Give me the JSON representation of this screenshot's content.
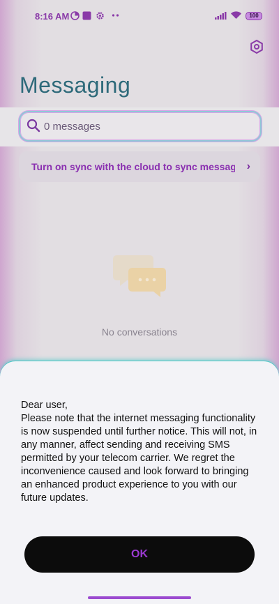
{
  "status_bar": {
    "time": "8:16 AM",
    "battery": "100",
    "icons": [
      "data-saver-icon",
      "app-notification-icon",
      "settings-notification-icon",
      "more-dots-icon",
      "signal-icon",
      "wifi-icon",
      "battery-icon"
    ]
  },
  "header": {
    "title": "Messaging",
    "settings_icon": "gear-icon"
  },
  "search": {
    "placeholder": "0 messages"
  },
  "sync_banner": {
    "text": "Turn on sync with the cloud to sync messages",
    "chevron": "›"
  },
  "empty_state": {
    "text": "No conversations",
    "icon": "chat-bubbles-icon"
  },
  "dialog": {
    "lines": [
      "Dear user,",
      "Please note that the internet messaging functionality is now suspended until further notice. This will not, in any manner, affect sending and receiving SMS permitted by your telecom carrier. We regret the inconvenience caused and look forward to bringing an enhanced product experience to you with our future updates."
    ],
    "ok_label": "OK"
  },
  "colors": {
    "accent": "#8a3aa8",
    "title": "#2e6a7a",
    "button_bg": "#0c0c0c",
    "button_text": "#9a3ad0"
  }
}
